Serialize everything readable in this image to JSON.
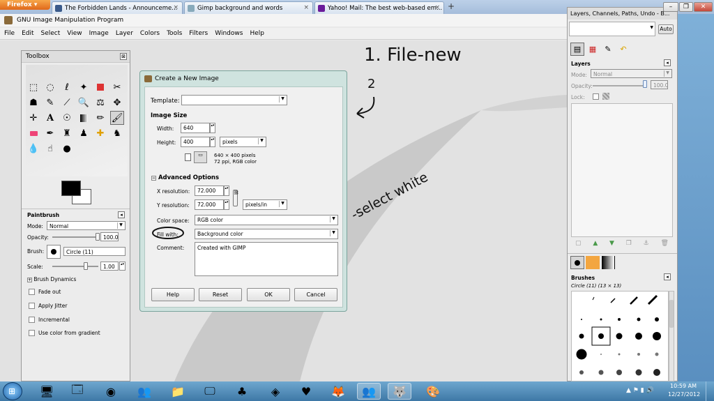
{
  "browser": {
    "menu_label": "Firefox",
    "tabs": [
      {
        "label": "The Forbidden Lands - Announceme...",
        "close": "×"
      },
      {
        "label": "Gimp background and words",
        "close": "×"
      },
      {
        "label": "Yahoo! Mail: The best web-based em...",
        "close": "×"
      }
    ],
    "new_tab": "+"
  },
  "window": {
    "title": "GNU Image Manipulation Program",
    "menus": [
      "File",
      "Edit",
      "Select",
      "View",
      "Image",
      "Layer",
      "Colors",
      "Tools",
      "Filters",
      "Windows",
      "Help"
    ]
  },
  "annotations": {
    "step1": "1. File-new",
    "step2": "2",
    "select_white": "-select white"
  },
  "toolbox": {
    "title": "Toolbox",
    "close": "⊠",
    "tool_options": {
      "title": "Paintbrush",
      "mode_label": "Mode:",
      "mode_value": "Normal",
      "opacity_label": "Opacity:",
      "opacity_value": "100.0",
      "opacity_fraction": 1.0,
      "brush_label": "Brush:",
      "brush_value": "Circle (11)",
      "scale_label": "Scale:",
      "scale_value": "1.00",
      "scale_fraction": 0.72,
      "brush_dynamics": "Brush Dynamics",
      "fade_out": "Fade out",
      "apply_jitter": "Apply Jitter",
      "incremental": "Incremental",
      "use_color_gradient": "Use color from gradient"
    }
  },
  "dialog": {
    "title": "Create a New Image",
    "template_label": "Template:",
    "template_value": "",
    "image_size_label": "Image Size",
    "width_label": "Width:",
    "width_value": "640",
    "height_label": "Height:",
    "height_value": "400",
    "units_value": "pixels",
    "size_info_1": "640 × 400 pixels",
    "size_info_2": "72 ppi, RGB color",
    "advanced_label": "Advanced Options",
    "xres_label": "X resolution:",
    "xres_value": "72.000",
    "yres_label": "Y resolution:",
    "yres_value": "72.000",
    "res_units_value": "pixels/in",
    "colorspace_label": "Color space:",
    "colorspace_value": "RGB color",
    "fill_label": "Fill with:",
    "fill_value": "Background color",
    "comment_label": "Comment:",
    "comment_value": "Created with GIMP",
    "buttons": {
      "help": "Help",
      "reset": "Reset",
      "ok": "OK",
      "cancel": "Cancel"
    }
  },
  "dock": {
    "title": "Layers, Channels, Paths, Undo - B...",
    "auto_label": "Auto",
    "layers": {
      "title": "Layers",
      "mode_label": "Mode:",
      "mode_value": "Normal",
      "opacity_label": "Opacity:",
      "opacity_value": "100.0",
      "opacity_fraction": 1.0,
      "lock_label": "Lock:"
    },
    "brushes": {
      "title": "Brushes",
      "subtitle": "Circle (11) (13 × 13)"
    }
  },
  "taskbar": {
    "time": "10:59 AM",
    "date": "12/27/2012"
  },
  "colors": {
    "dialog_frame": "#cfe3df",
    "firefox_orange": "#e0681a",
    "taskbar": "#3e78a6"
  }
}
